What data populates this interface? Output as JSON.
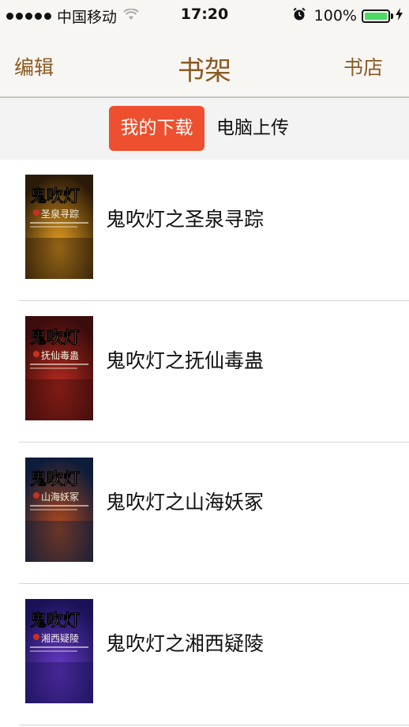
{
  "status_bar": {
    "carrier": "中国移动",
    "time": "17:20",
    "battery_percent": "100%"
  },
  "nav": {
    "left_label": "编辑",
    "title": "书架",
    "right_label": "书店"
  },
  "segments": {
    "active": "我的下载",
    "inactive": "电脑上传"
  },
  "books": [
    {
      "title": "鬼吹灯之圣泉寻踪",
      "cover": {
        "series": "鬼吹灯",
        "subtitle": "圣泉寻踪",
        "palette": [
          "#2b1a08",
          "#e8a020"
        ]
      }
    },
    {
      "title": "鬼吹灯之抚仙毒蛊",
      "cover": {
        "series": "鬼吹灯",
        "subtitle": "抚仙毒蛊",
        "palette": [
          "#3a0c0c",
          "#b82a1e"
        ]
      }
    },
    {
      "title": "鬼吹灯之山海妖冢",
      "cover": {
        "series": "鬼吹灯",
        "subtitle": "山海妖冢",
        "palette": [
          "#0d1c3a",
          "#b84a1a"
        ]
      }
    },
    {
      "title": "鬼吹灯之湘西疑陵",
      "cover": {
        "series": "鬼吹灯",
        "subtitle": "湘西疑陵",
        "palette": [
          "#1a1258",
          "#6a3ac8"
        ]
      }
    }
  ],
  "colors": {
    "accent": "#ee4f2e",
    "nav_text": "#8b5a22",
    "battery": "#4cd964"
  }
}
